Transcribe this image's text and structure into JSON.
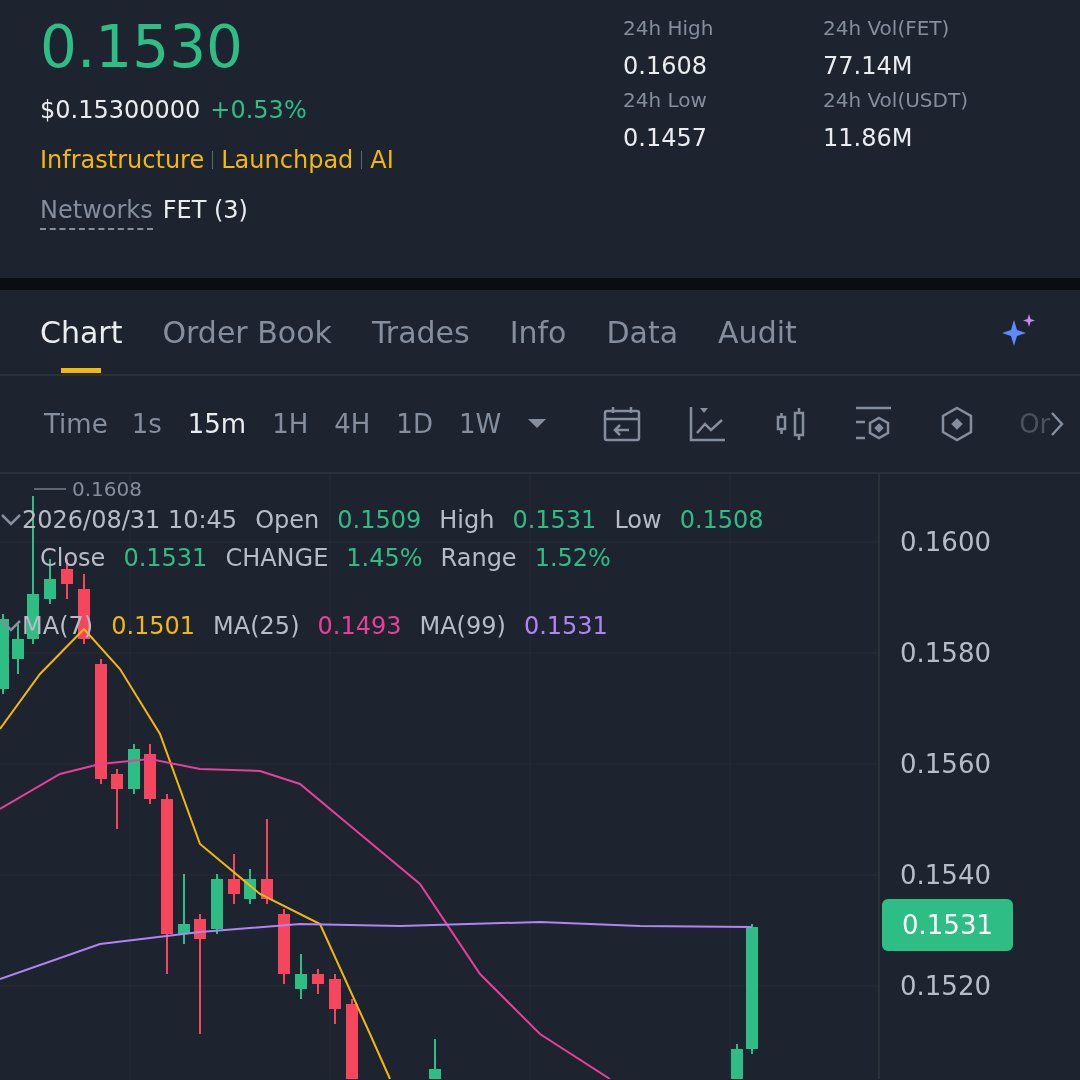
{
  "ticker": {
    "price": "0.1530",
    "usd_price": "$0.15300000",
    "change": "+0.53%",
    "tags": [
      "Infrastructure",
      "Launchpad",
      "AI"
    ],
    "networks_label": "Networks",
    "networks_value": "FET (3)"
  },
  "stats": [
    {
      "label": "24h High",
      "value": "0.1608"
    },
    {
      "label": "24h Vol(FET)",
      "value": "77.14M"
    },
    {
      "label": "24h Low",
      "value": "0.1457"
    },
    {
      "label": "24h Vol(USDT)",
      "value": "11.86M"
    }
  ],
  "tabs": [
    {
      "label": "Chart",
      "selected": true
    },
    {
      "label": "Order Book",
      "selected": false
    },
    {
      "label": "Trades",
      "selected": false
    },
    {
      "label": "Info",
      "selected": false
    },
    {
      "label": "Data",
      "selected": false
    },
    {
      "label": "Audit",
      "selected": false
    }
  ],
  "toolbar": {
    "time_label": "Time",
    "intervals": [
      {
        "label": "1s",
        "selected": false
      },
      {
        "label": "15m",
        "selected": true
      },
      {
        "label": "1H",
        "selected": false
      },
      {
        "label": "4H",
        "selected": false
      },
      {
        "label": "1D",
        "selected": false
      },
      {
        "label": "1W",
        "selected": false
      }
    ],
    "more_label": "Or"
  },
  "chart": {
    "high_marker": "0.1608",
    "datetime": "2026/08/31 10:45",
    "ohlc": [
      {
        "label": "Open",
        "value": "0.1509"
      },
      {
        "label": "High",
        "value": "0.1531"
      },
      {
        "label": "Low",
        "value": "0.1508"
      },
      {
        "label": "Close",
        "value": "0.1531"
      },
      {
        "label": "CHANGE",
        "value": "1.45%"
      },
      {
        "label": "Range",
        "value": "1.52%"
      }
    ],
    "moving_averages": [
      {
        "label": "MA(7)",
        "value": "0.1501",
        "color": "#f0b90b"
      },
      {
        "label": "MA(25)",
        "value": "0.1493",
        "color": "#e8409a"
      },
      {
        "label": "MA(99)",
        "value": "0.1531",
        "color": "#b084f5"
      }
    ],
    "price_axis": [
      "0.1600",
      "0.1580",
      "0.1560",
      "0.1540",
      "0.1520"
    ],
    "last_price": "0.1531"
  }
}
